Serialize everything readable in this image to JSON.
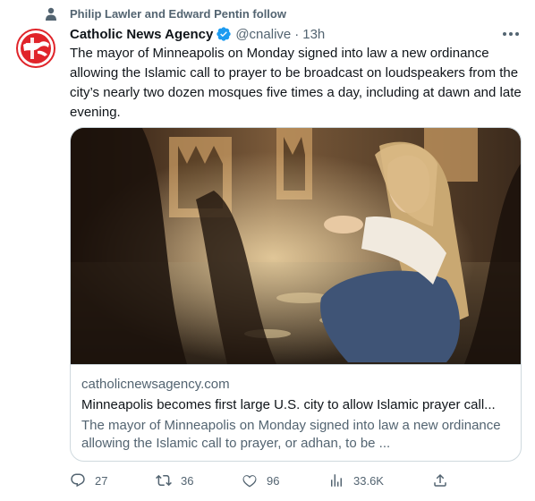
{
  "social_context": "Philip Lawler and Edward Pentin follow",
  "author": {
    "name": "Catholic News Agency",
    "handle": "@cnalive",
    "separator": "·",
    "time": "13h"
  },
  "tweet_text": "The mayor of Minneapolis on Monday signed into law a new ordinance allowing the Islamic call to prayer to be broadcast on loudspeakers from the city’s nearly two dozen mosques five times a day, including at dawn and late evening.",
  "card": {
    "domain": "catholicnewsagency.com",
    "title": "Minneapolis becomes first large U.S. city to allow Islamic prayer call...",
    "description": "The mayor of Minneapolis on Monday signed into law a new ordinance allowing the Islamic call to prayer, or adhan, to be ..."
  },
  "actions": {
    "replies": "27",
    "reposts": "36",
    "likes": "96",
    "views": "33.6K"
  },
  "colors": {
    "text": "#0f1419",
    "secondary": "#536471",
    "border": "#cfd9de",
    "verified": "#1d9bf0",
    "logo_red": "#e0242a"
  }
}
